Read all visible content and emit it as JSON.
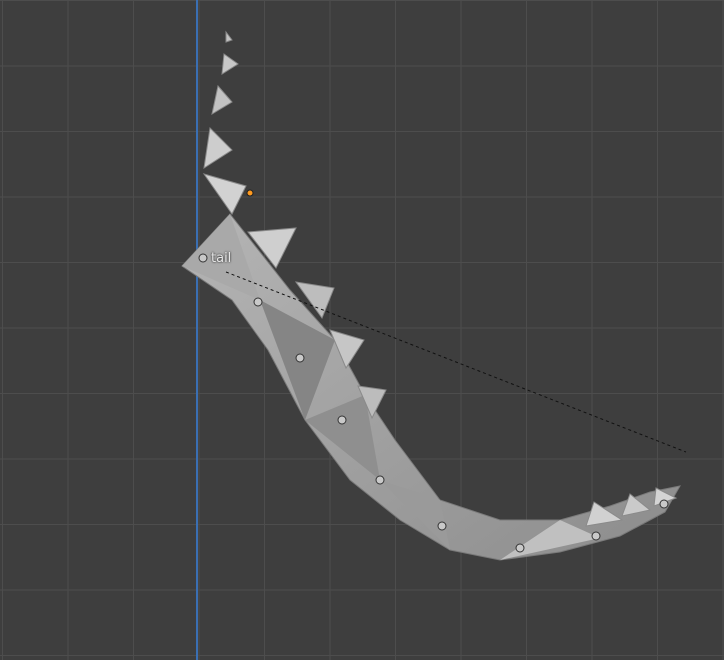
{
  "viewport": {
    "bone_label": "tail",
    "colors": {
      "background": "#3e3e3e",
      "grid": "#4d4d4d",
      "axis": "#3a6fb3",
      "mesh": "#9d9d9d",
      "origin": "#ff9a1f",
      "relationship_line": "#111111"
    },
    "icons": [
      "origin-dot-icon",
      "bone-joint-icon"
    ]
  }
}
